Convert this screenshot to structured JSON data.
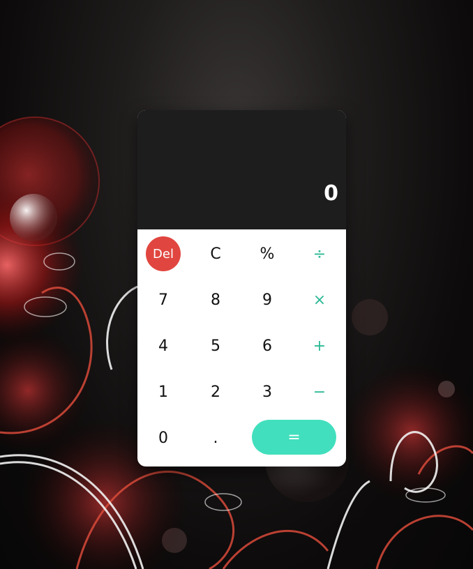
{
  "display": {
    "value": "0"
  },
  "keys": {
    "del": "Del",
    "clear": "C",
    "percent": "%",
    "divide": "÷",
    "seven": "7",
    "eight": "8",
    "nine": "9",
    "multiply": "×",
    "four": "4",
    "five": "5",
    "six": "6",
    "plus": "+",
    "one": "1",
    "two": "2",
    "three": "3",
    "minus": "−",
    "zero": "0",
    "dot": ".",
    "equals": "="
  },
  "colors": {
    "display_bg": "#1d1d1d",
    "keypad_bg": "#ffffff",
    "del": "#e0463f",
    "equals": "#41dfbd",
    "operator": "#2cb995"
  }
}
